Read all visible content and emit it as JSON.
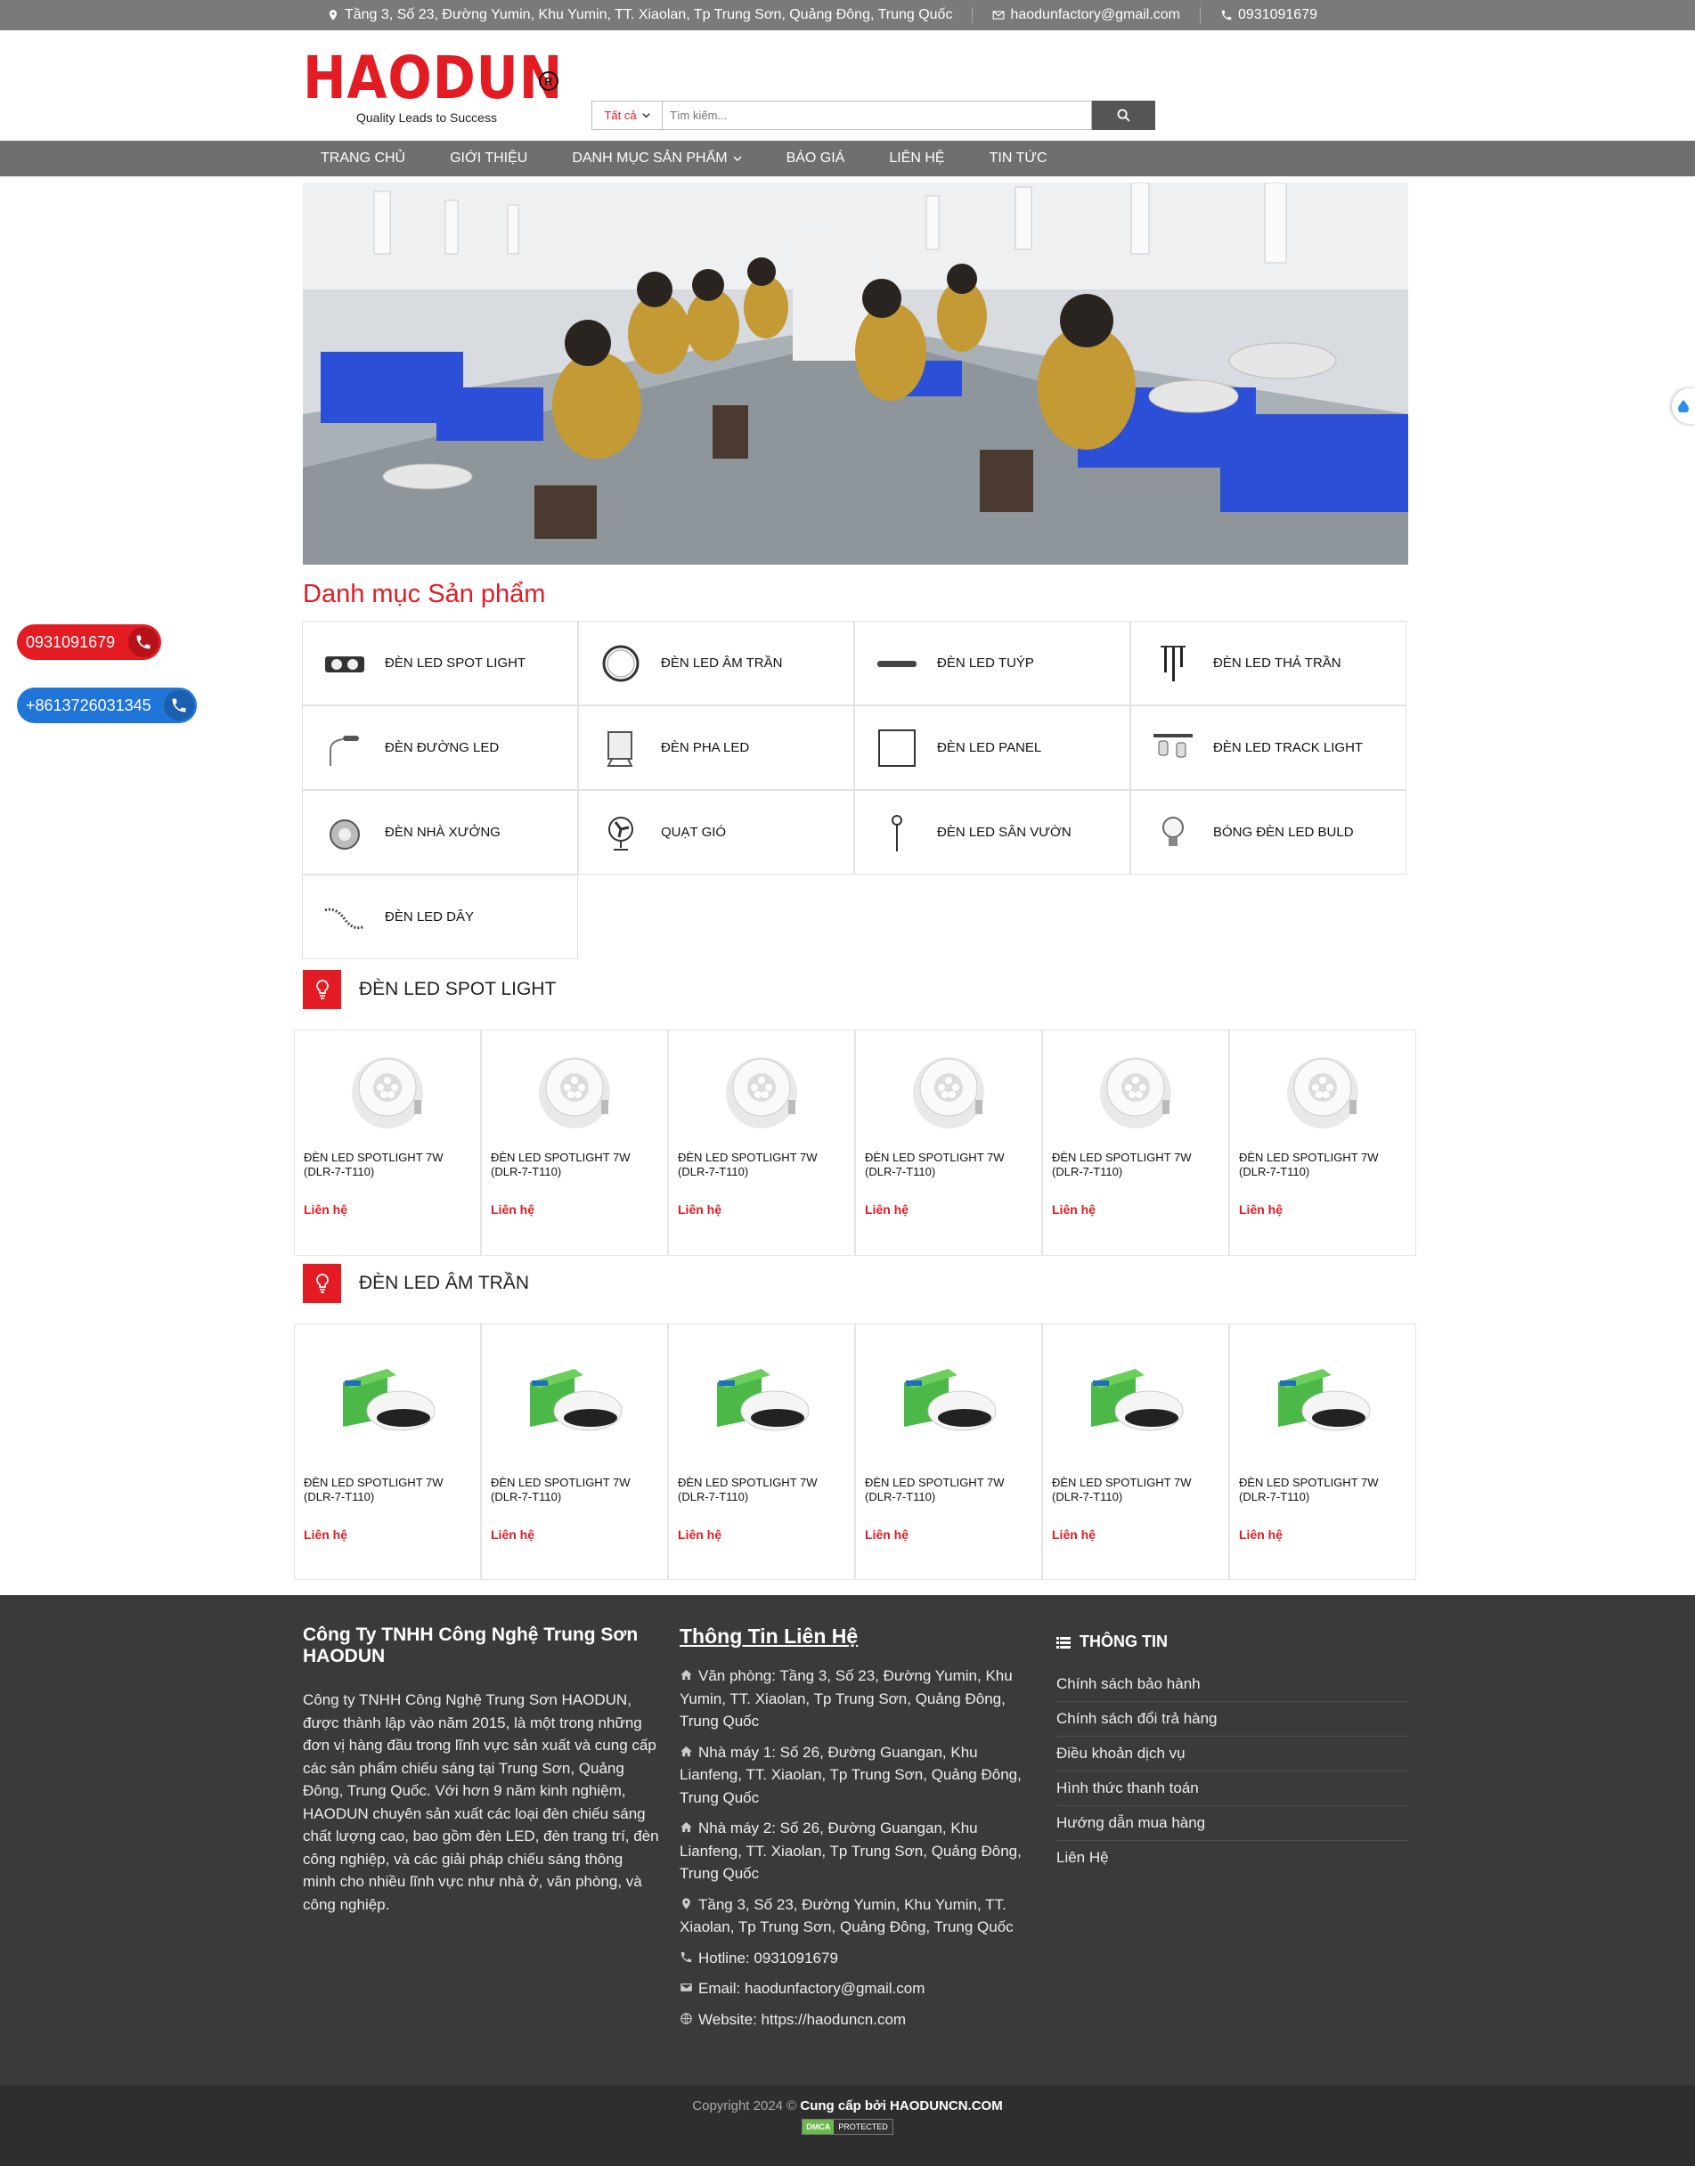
{
  "topbar": {
    "address": "Tầng 3, Số 23, Đường Yumin, Khu Yumin, TT. Xiaolan, Tp Trung Sơn, Quảng Đông, Trung Quốc",
    "email": "haodunfactory@gmail.com",
    "phone": "0931091679"
  },
  "logo": {
    "word": "HAODUN",
    "reg": "R",
    "tagline": "Quality Leads to Success"
  },
  "search": {
    "category": "Tất cả",
    "placeholder": "Tìm kiếm..."
  },
  "nav": [
    {
      "label": "Trang chủ"
    },
    {
      "label": "Giới thiệu"
    },
    {
      "label": "Danh mục sản phẩm"
    },
    {
      "label": "Báo giá"
    },
    {
      "label": "Liên hệ"
    },
    {
      "label": "Tin tức"
    }
  ],
  "float_phones": [
    "0931091679",
    "+8613726031345"
  ],
  "categories_title": "Danh mục Sản phẩm",
  "categories": [
    {
      "label": "Đèn Led SPOT LIGHT",
      "icon": "spotlight-fixture-icon"
    },
    {
      "label": "Đèn LED Âm trần",
      "icon": "downlight-ring-icon"
    },
    {
      "label": "ĐÈN LED TUÝP",
      "icon": "tube-light-icon"
    },
    {
      "label": "ĐÈN LED THẢ TRẦN",
      "icon": "pendant-light-icon"
    },
    {
      "label": "ĐÈN ĐƯỜNG LED",
      "icon": "street-light-icon"
    },
    {
      "label": "ĐÈN PHA LED",
      "icon": "flood-light-icon"
    },
    {
      "label": "ĐÈN LED PANEL",
      "icon": "panel-light-icon"
    },
    {
      "label": "ĐÈN LED TRACK LIGHT",
      "icon": "track-light-icon"
    },
    {
      "label": "ĐÈN NHÀ XƯỞNG",
      "icon": "highbay-light-icon"
    },
    {
      "label": "QUẠT GIÓ",
      "icon": "fan-icon"
    },
    {
      "label": "ĐÈN LED SÂN VƯỜN",
      "icon": "garden-light-icon"
    },
    {
      "label": "BÓNG ĐÈN LED BULD",
      "icon": "bulb-icon"
    },
    {
      "label": "ĐÈN LED DÂY",
      "icon": "strip-light-icon"
    }
  ],
  "sections": [
    {
      "title": "ĐÈN LED SPOT LIGHT",
      "products": [
        {
          "name": "ĐÈN LED SPOTLIGHT 7W (DLR-7-T110)",
          "price": "Liên hệ"
        },
        {
          "name": "ĐÈN LED SPOTLIGHT 7W (DLR-7-T110)",
          "price": "Liên hệ"
        },
        {
          "name": "ĐÈN LED SPOTLIGHT 7W (DLR-7-T110)",
          "price": "Liên hệ"
        },
        {
          "name": "ĐÈN LED SPOTLIGHT 7W (DLR-7-T110)",
          "price": "Liên hệ"
        },
        {
          "name": "ĐÈN LED SPOTLIGHT 7W (DLR-7-T110)",
          "price": "Liên hệ"
        },
        {
          "name": "ĐÈN LED SPOTLIGHT 7W (DLR-7-T110)",
          "price": "Liên hệ"
        }
      ]
    },
    {
      "title": "ĐÈN LED ÂM TRẦN",
      "products": [
        {
          "name": "ĐÈN LED SPOTLIGHT 7W (DLR-7-T110)",
          "price": "Liên hệ"
        },
        {
          "name": "ĐÈN LED SPOTLIGHT 7W (DLR-7-T110)",
          "price": "Liên hệ"
        },
        {
          "name": "ĐÈN LED SPOTLIGHT 7W (DLR-7-T110)",
          "price": "Liên hệ"
        },
        {
          "name": "ĐÈN LED SPOTLIGHT 7W (DLR-7-T110)",
          "price": "Liên hệ"
        },
        {
          "name": "ĐÈN LED SPOTLIGHT 7W (DLR-7-T110)",
          "price": "Liên hệ"
        },
        {
          "name": "ĐÈN LED SPOTLIGHT 7W (DLR-7-T110)",
          "price": "Liên hệ"
        }
      ]
    }
  ],
  "footer": {
    "company_title": "Công Ty TNHH Công Nghệ Trung Sơn HAODUN",
    "company_desc": "Công ty TNHH Công Nghệ Trung Sơn HAODUN, được thành lập vào năm 2015, là một trong những đơn vị hàng đầu trong lĩnh vực sản xuất và cung cấp các sản phẩm chiếu sáng tại Trung Sơn, Quảng Đông, Trung Quốc. Với hơn 9 năm kinh nghiệm, HAODUN chuyên sản xuất các loại đèn chiếu sáng chất lượng cao, bao gồm đèn LED, đèn trang trí, đèn công nghiệp, và các giải pháp chiếu sáng thông minh cho nhiều lĩnh vực như nhà ở, văn phòng, và công nghiệp.",
    "contact_title": "Thông Tin Liên Hệ",
    "contact": [
      {
        "icon": "home-icon",
        "text": "Văn phòng: Tầng 3, Số 23, Đường Yumin, Khu Yumin, TT. Xiaolan, Tp Trung Sơn, Quảng Đông, Trung Quốc"
      },
      {
        "icon": "home-icon",
        "text": "Nhà máy 1: Số 26, Đường Guangan, Khu Lianfeng, TT. Xiaolan, Tp Trung Sơn, Quảng Đông, Trung Quốc"
      },
      {
        "icon": "home-icon",
        "text": "Nhà máy 2: Số 26, Đường Guangan, Khu Lianfeng, TT. Xiaolan, Tp Trung Sơn, Quảng Đông, Trung Quốc"
      },
      {
        "icon": "map-pin-icon",
        "text": "Tầng 3, Số 23, Đường Yumin, Khu Yumin, TT. Xiaolan, Tp Trung Sơn, Quảng Đông, Trung Quốc"
      },
      {
        "icon": "phone-icon",
        "text": "Hotline: 0931091679"
      },
      {
        "icon": "mail-icon",
        "text": "Email: haodunfactory@gmail.com"
      },
      {
        "icon": "globe-icon",
        "text": "Website: https://haoduncn.com"
      }
    ],
    "info_title": "Thông tin",
    "info_links": [
      "Chính sách bảo hành",
      "Chính sách đổi trả hàng",
      "Điều khoản dịch vụ",
      "Hình thức thanh toán",
      "Hướng dẫn mua hàng",
      "Liên Hệ"
    ],
    "copyright": "Copyright 2024 ©",
    "provider": "Cung cấp bởi HAODUNCN.COM",
    "dmca_left": "DMCA",
    "dmca_right": "PROTECTED"
  },
  "colors": {
    "brand_red": "#e31b23",
    "nav_gray": "#6f6f6f",
    "footer_bg": "#3a3a3a",
    "phone_blue": "#1f75d8"
  }
}
